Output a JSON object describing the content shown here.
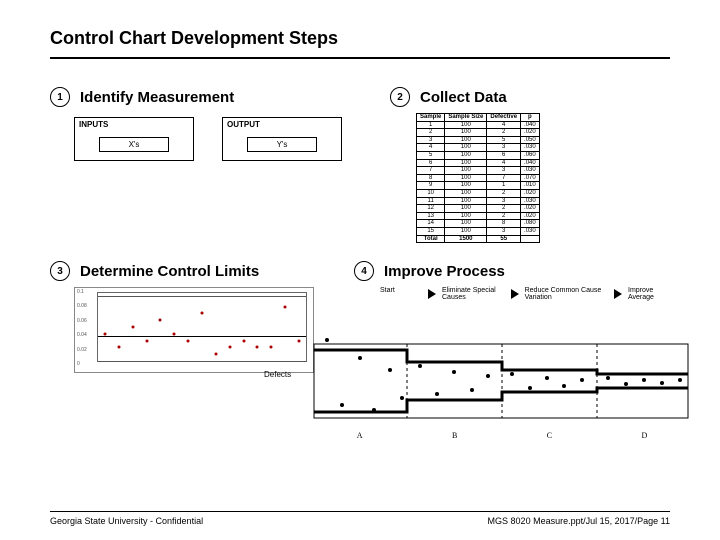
{
  "title": "Control Chart Development Steps",
  "steps": [
    {
      "num": "1",
      "label": "Identify Measurement"
    },
    {
      "num": "2",
      "label": "Collect Data"
    },
    {
      "num": "3",
      "label": "Determine Control Limits"
    },
    {
      "num": "4",
      "label": "Improve Process"
    }
  ],
  "io": {
    "inputs_head": "INPUTS",
    "inputs_box": "X's",
    "output_head": "OUTPUT",
    "output_box": "Y's"
  },
  "data_table": {
    "headers": [
      "Sample",
      "Sample Size",
      "Defective",
      "p"
    ],
    "rows": [
      [
        "1",
        "100",
        "4",
        ".040"
      ],
      [
        "2",
        "100",
        "2",
        ".020"
      ],
      [
        "3",
        "100",
        "5",
        ".050"
      ],
      [
        "4",
        "100",
        "3",
        ".030"
      ],
      [
        "5",
        "100",
        "6",
        ".060"
      ],
      [
        "6",
        "100",
        "4",
        ".040"
      ],
      [
        "7",
        "100",
        "3",
        ".030"
      ],
      [
        "8",
        "100",
        "7",
        ".070"
      ],
      [
        "9",
        "100",
        "1",
        ".010"
      ],
      [
        "10",
        "100",
        "2",
        ".020"
      ],
      [
        "11",
        "100",
        "3",
        ".030"
      ],
      [
        "12",
        "100",
        "2",
        ".020"
      ],
      [
        "13",
        "100",
        "2",
        ".020"
      ],
      [
        "14",
        "100",
        "8",
        ".080"
      ],
      [
        "15",
        "100",
        "3",
        ".030"
      ]
    ],
    "total_row": [
      "Total",
      "1500",
      "55",
      ""
    ]
  },
  "flow": {
    "start": "Start",
    "b1": "Eliminate Special Causes",
    "b2": "Reduce Common Cause Variation",
    "b3": "Improve Average"
  },
  "funnel": {
    "side_label": "Defects",
    "phases": [
      "A",
      "B",
      "C",
      "D"
    ]
  },
  "chart_data": {
    "type": "scatter",
    "title": "",
    "xlabel": "",
    "ylabel": "",
    "ylim": [
      0,
      0.1
    ],
    "yticks": [
      0.1,
      0.08,
      0.06,
      0.04,
      0.02,
      0
    ],
    "ucl": 0.095,
    "cl": 0.037,
    "lcl": 0.0,
    "x": [
      1,
      2,
      3,
      4,
      5,
      6,
      7,
      8,
      9,
      10,
      11,
      12,
      13,
      14,
      15
    ],
    "values": [
      0.04,
      0.02,
      0.05,
      0.03,
      0.06,
      0.04,
      0.03,
      0.07,
      0.01,
      0.02,
      0.03,
      0.02,
      0.02,
      0.08,
      0.03
    ]
  },
  "footer": {
    "left": "Georgia State University - Confidential",
    "right": "MGS 8020 Measure.ppt/Jul 15, 2017/Page 11"
  }
}
